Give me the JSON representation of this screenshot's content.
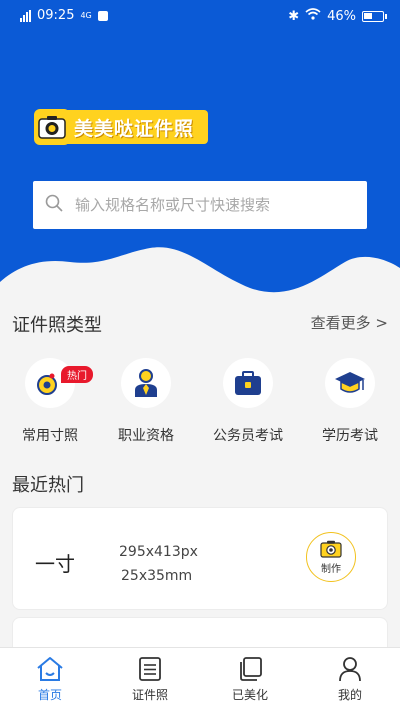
{
  "colors": {
    "primary": "#0b5ad6",
    "accent": "#ffd21f",
    "hot": "#e8192c",
    "tab_active": "#2a7be4"
  },
  "status_bar": {
    "time": "09:25",
    "carrier_small": "4G",
    "battery": "46%",
    "battery_level": 0.46
  },
  "brand": {
    "name": "美美哒证件照",
    "icon": "camera-icon"
  },
  "search": {
    "placeholder": "输入规格名称或尺寸快速搜索",
    "icon": "search-icon"
  },
  "categories": {
    "title": "证件照类型",
    "more_label": "查看更多 >",
    "items": [
      {
        "label": "常用寸照",
        "icon": "common-size-icon",
        "badge": "热门"
      },
      {
        "label": "职业资格",
        "icon": "professional-icon"
      },
      {
        "label": "公务员考试",
        "icon": "civil-service-icon"
      },
      {
        "label": "学历考试",
        "icon": "graduation-cap-icon"
      }
    ]
  },
  "recent": {
    "title": "最近热门",
    "items": [
      {
        "name": "一寸",
        "pixels": "295x413px",
        "mm": "25x35mm",
        "action": "制作"
      }
    ]
  },
  "tabs": [
    {
      "label": "首页",
      "icon": "home-icon",
      "active": true
    },
    {
      "label": "证件照",
      "icon": "document-icon",
      "active": false
    },
    {
      "label": "已美化",
      "icon": "gallery-icon",
      "active": false
    },
    {
      "label": "我的",
      "icon": "user-icon",
      "active": false
    }
  ]
}
